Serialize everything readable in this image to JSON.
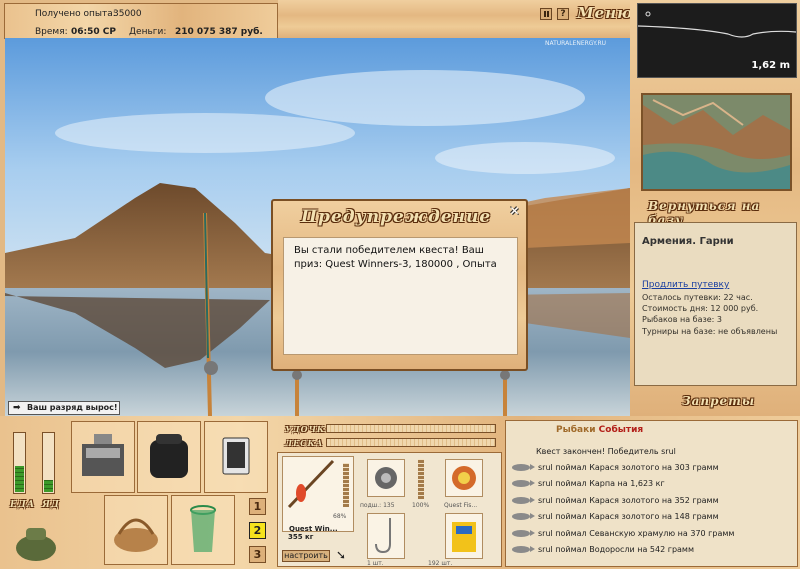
{
  "status": {
    "experience_label": "Получено опыта:",
    "experience_value": "35000",
    "time_label": "Время:",
    "time_value": "06:50 СР",
    "money_label": "Деньги:",
    "money_value": "210 075 387 руб."
  },
  "header": {
    "menu_label": "Меню",
    "watermark": "NATURALENERGY.RU"
  },
  "depth": {
    "value": "1,62 m"
  },
  "right": {
    "return_label": "Вернуться на базу",
    "location_title": "Армения. Гарни",
    "extend_link": "Продлить путевку",
    "trip_left": "Осталось путевки: 22 час.",
    "day_cost": "Стоимость дня: 12 000 руб.",
    "fishers": "Рыбаков на базе: 3",
    "tournaments": "Турниры на базе: не объявлены",
    "bans_label": "Запреты"
  },
  "dialog": {
    "title": "Предупреждение",
    "message": "Вы стали победителем квеста! Ваш приз: Quest Winners-3, 180000 , Опыта"
  },
  "notice": {
    "text": "Ваш разряд вырос!"
  },
  "gauges": {
    "food_label": "ЕДА",
    "drink_label": "ЯД",
    "food_level": 0.45,
    "drink_level": 0.2
  },
  "bars": {
    "rod_label": "УДОЧКА",
    "line_label": "ЛЕСКА"
  },
  "buttons": {
    "num1": "1",
    "num2": "2",
    "num3": "3",
    "setup_label": "настроить"
  },
  "tackle": {
    "rod_name": "Quest Win...",
    "rod_weight": "355 кг",
    "rod_percent": "68%",
    "reel_label": "подш.: 135",
    "reel_percent": "100%",
    "line_name": "Quest Fis...",
    "hook_count": "1 шт.",
    "bait_count": "192 шт."
  },
  "events": {
    "title_a": "Рыбаки",
    "title_b": "События",
    "lines": [
      "Квест закончен! Победитель srul",
      "srul поймал Карася золотого на 303 грамм",
      "srul поймал Карпа на 1,623 кг",
      "srul поймал Карася золотого на 352 грамм",
      "srul поймал Карася золотого на 148 грамм",
      "srul поймал Севанскую храмулю на 370 грамм",
      "srul поймал Водоросли на 542 грамм"
    ]
  },
  "colors": {
    "accent_yellow": "#f5e21c",
    "wood": "#e4b882",
    "title_outline": "#5a2c0c"
  }
}
